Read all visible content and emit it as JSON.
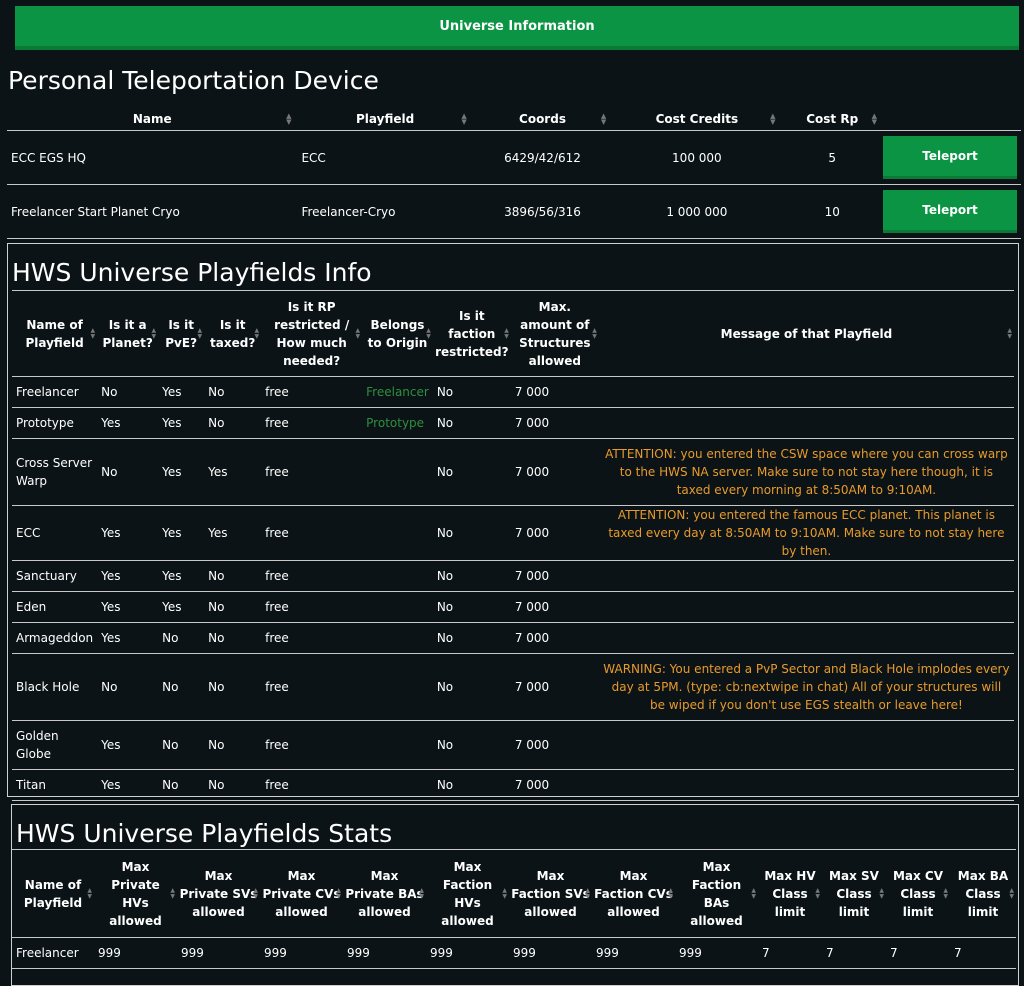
{
  "topbar": {
    "label": "Universe Information"
  },
  "teleport": {
    "title": "Personal Teleportation Device",
    "columns": [
      "Name",
      "Playfield",
      "Coords",
      "Cost Credits",
      "Cost Rp"
    ],
    "rows": [
      {
        "name": "ECC EGS HQ",
        "playfield": "ECC",
        "coords": "6429/42/612",
        "credits": "100 000",
        "rp": "5",
        "button": "Teleport"
      },
      {
        "name": "Freelancer Start Planet Cryo",
        "playfield": "Freelancer-Cryo",
        "coords": "3896/56/316",
        "credits": "1 000 000",
        "rp": "10",
        "button": "Teleport"
      }
    ]
  },
  "info": {
    "title": "HWS Universe Playfields Info",
    "columns": [
      "Name of Playfield",
      "Is it a Planet?",
      "Is it PvE?",
      "Is it taxed?",
      "Is it RP restricted / How much needed?",
      "Belongs to Origin",
      "Is it faction restricted?",
      "Max. amount of Structures allowed",
      "Message of that Playfield"
    ],
    "rows": [
      {
        "name": "Freelancer",
        "planet": "No",
        "pve": "Yes",
        "taxed": "No",
        "rp": "free",
        "origin": "Freelancer",
        "faction": "No",
        "max": "7 000",
        "msg": ""
      },
      {
        "name": "Prototype",
        "planet": "Yes",
        "pve": "Yes",
        "taxed": "No",
        "rp": "free",
        "origin": "Prototype",
        "faction": "No",
        "max": "7 000",
        "msg": ""
      },
      {
        "name": "Cross Server Warp",
        "planet": "No",
        "pve": "Yes",
        "taxed": "Yes",
        "rp": "free",
        "origin": "",
        "faction": "No",
        "max": "7 000",
        "msg": "ATTENTION: you entered the CSW space where you can cross warp to the HWS NA server. Make sure to not stay here though, it is taxed every morning at 8:50AM to 9:10AM."
      },
      {
        "name": "ECC",
        "planet": "Yes",
        "pve": "Yes",
        "taxed": "Yes",
        "rp": "free",
        "origin": "",
        "faction": "No",
        "max": "7 000",
        "msg": "ATTENTION: you entered the famous ECC planet. This planet is taxed every day at 8:50AM to 9:10AM. Make sure to not stay here by then."
      },
      {
        "name": "Sanctuary",
        "planet": "Yes",
        "pve": "Yes",
        "taxed": "No",
        "rp": "free",
        "origin": "",
        "faction": "No",
        "max": "7 000",
        "msg": ""
      },
      {
        "name": "Eden",
        "planet": "Yes",
        "pve": "Yes",
        "taxed": "No",
        "rp": "free",
        "origin": "",
        "faction": "No",
        "max": "7 000",
        "msg": ""
      },
      {
        "name": "Armageddon",
        "planet": "Yes",
        "pve": "No",
        "taxed": "No",
        "rp": "free",
        "origin": "",
        "faction": "No",
        "max": "7 000",
        "msg": ""
      },
      {
        "name": "Black Hole",
        "planet": "No",
        "pve": "No",
        "taxed": "No",
        "rp": "free",
        "origin": "",
        "faction": "No",
        "max": "7 000",
        "msg": "WARNING: You entered a PvP Sector and Black Hole implodes every day at 5PM. (type: cb:nextwipe in chat) All of your structures will be wiped if you don't use EGS stealth or leave here!"
      },
      {
        "name": "Golden Globe",
        "planet": "Yes",
        "pve": "No",
        "taxed": "No",
        "rp": "free",
        "origin": "",
        "faction": "No",
        "max": "7 000",
        "msg": ""
      },
      {
        "name": "Titan",
        "planet": "Yes",
        "pve": "No",
        "taxed": "No",
        "rp": "free",
        "origin": "",
        "faction": "No",
        "max": "7 000",
        "msg": ""
      }
    ]
  },
  "stats": {
    "title": "HWS Universe Playfields Stats",
    "columns": [
      "Name of Playfield",
      "Max Private HVs allowed",
      "Max Private SVs allowed",
      "Max Private CVs allowed",
      "Max Private BAs allowed",
      "Max Faction HVs allowed",
      "Max Faction SVs allowed",
      "Max Faction CVs allowed",
      "Max Faction BAs allowed",
      "Max HV Class limit",
      "Max SV Class limit",
      "Max CV Class limit",
      "Max BA Class limit"
    ],
    "rows": [
      {
        "cells": [
          "Freelancer",
          "999",
          "999",
          "999",
          "999",
          "999",
          "999",
          "999",
          "999",
          "7",
          "7",
          "7",
          "7"
        ]
      }
    ]
  }
}
